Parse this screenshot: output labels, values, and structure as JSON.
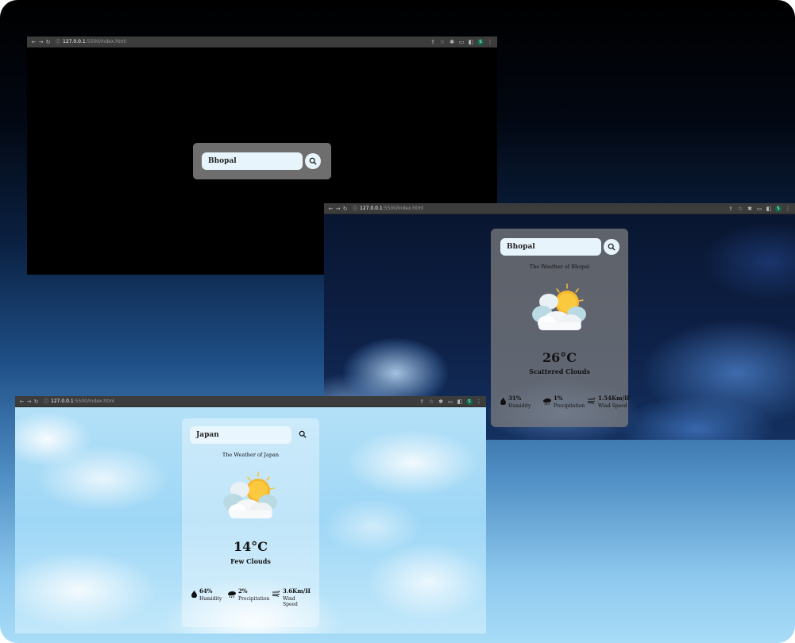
{
  "browser": {
    "url_host": "127.0.0.1",
    "url_path": ":5500/index.html"
  },
  "window_initial": {
    "search_value": "Bhopal"
  },
  "window_bhopal": {
    "search_value": "Bhopal",
    "heading": "The Weather of Bhopal",
    "temperature": "26°C",
    "description": "Scattered Clouds",
    "humidity_value": "31%",
    "humidity_label": "Humidity",
    "precip_value": "1%",
    "precip_label": "Precipitation",
    "wind_value": "1.54Km/H",
    "wind_label": "Wind Speed"
  },
  "window_japan": {
    "search_value": "Japan",
    "heading": "The Weather of Japan",
    "temperature": "14°C",
    "description": "Few Clouds",
    "humidity_value": "64%",
    "humidity_label": "Humidity",
    "precip_value": "2%",
    "precip_label": "Precipitation",
    "wind_value": "3.6Km/H",
    "wind_label_line1": "Wind",
    "wind_label_line2": "Speed"
  },
  "icons": [
    "back-icon",
    "forward-icon",
    "reload-icon",
    "info-icon",
    "share-icon",
    "star-icon",
    "extensions-icon",
    "cast-icon",
    "sidepanel-icon",
    "menu-icon",
    "search-icon",
    "weather-icon",
    "humidity-icon",
    "precipitation-icon",
    "wind-icon"
  ]
}
